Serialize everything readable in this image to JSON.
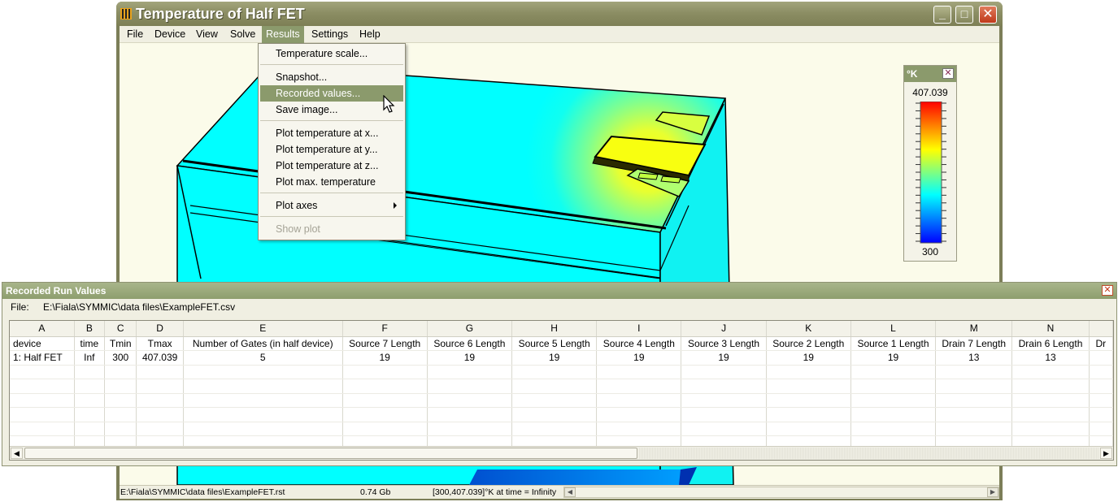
{
  "main_window": {
    "title": "Temperature of Half FET",
    "icon": "app-icon",
    "controls": {
      "minimize": "_",
      "maximize": "□",
      "close": "✕"
    }
  },
  "menubar": [
    "File",
    "Device",
    "View",
    "Solve",
    "Results",
    "Settings",
    "Help"
  ],
  "results_menu": {
    "items": [
      {
        "label": "Temperature scale..."
      },
      {
        "label": "Snapshot..."
      },
      {
        "label": "Recorded values...",
        "highlighted": true
      },
      {
        "label": "Save image..."
      },
      {
        "label": "Plot temperature at x..."
      },
      {
        "label": "Plot temperature at y..."
      },
      {
        "label": "Plot temperature at z..."
      },
      {
        "label": "Plot max. temperature"
      },
      {
        "label": "Plot axes",
        "submenu": true
      },
      {
        "label": "Show plot",
        "disabled": true
      }
    ]
  },
  "temperature_scale": {
    "unit": "°K",
    "max": "407.039",
    "min": "300",
    "close": "✕",
    "gradient_colors": [
      "#ff0000",
      "#ff8000",
      "#ffff00",
      "#80ff80",
      "#00ffff",
      "#0080ff",
      "#0000ff"
    ]
  },
  "statusbar": {
    "file": "E:\\Fiala\\SYMMIC\\data files\\ExampleFET.rst",
    "memory": "0.74 Gb",
    "range": "[300,407.039]°K at time = Infinity"
  },
  "recorded_values": {
    "title": "Recorded Run Values",
    "close": "✕",
    "file_label": "File:",
    "file_path": "E:\\Fiala\\SYMMIC\\data files\\ExampleFET.csv",
    "columns": [
      {
        "letter": "A",
        "header": "device",
        "value": "1: Half FET"
      },
      {
        "letter": "B",
        "header": "time",
        "value": "Inf"
      },
      {
        "letter": "C",
        "header": "Tmin",
        "value": "300"
      },
      {
        "letter": "D",
        "header": "Tmax",
        "value": "407.039"
      },
      {
        "letter": "E",
        "header": "Number of Gates (in half device)",
        "value": "5"
      },
      {
        "letter": "F",
        "header": "Source 7 Length",
        "value": "19"
      },
      {
        "letter": "G",
        "header": "Source 6 Length",
        "value": "19"
      },
      {
        "letter": "H",
        "header": "Source 5 Length",
        "value": "19"
      },
      {
        "letter": "I",
        "header": "Source 4 Length",
        "value": "19"
      },
      {
        "letter": "J",
        "header": "Source 3 Length",
        "value": "19"
      },
      {
        "letter": "K",
        "header": "Source 2 Length",
        "value": "19"
      },
      {
        "letter": "L",
        "header": "Source 1 Length",
        "value": "19"
      },
      {
        "letter": "M",
        "header": "Drain 7 Length",
        "value": "13"
      },
      {
        "letter": "N",
        "header": "Drain 6 Length",
        "value": "13"
      },
      {
        "letter": "",
        "header": "Dr",
        "value": ""
      }
    ],
    "scroll_left": "◀",
    "scroll_right": "▶"
  }
}
